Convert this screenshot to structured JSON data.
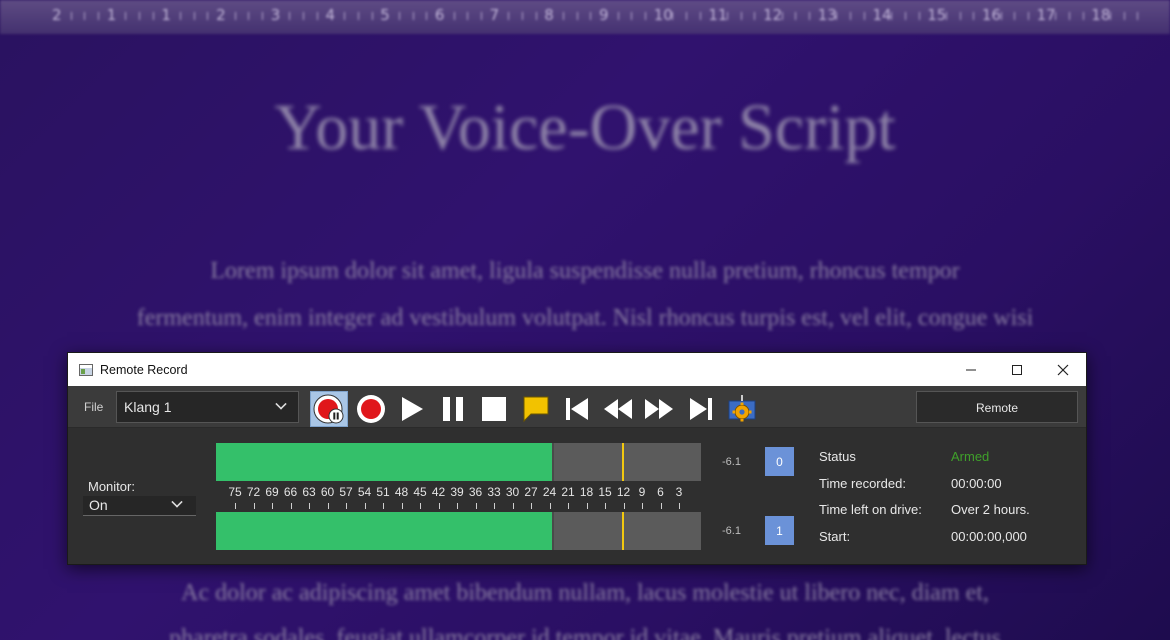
{
  "background": {
    "ruler_numbers": [
      "2",
      "1",
      "1",
      "2",
      "3",
      "4",
      "5",
      "6",
      "7",
      "8",
      "9",
      "10",
      "11",
      "12",
      "13",
      "14",
      "15",
      "16",
      "17",
      "18"
    ],
    "title": "Your Voice-Over Script",
    "paragraph_lines": [
      "Lorem ipsum dolor sit amet, ligula suspendisse nulla pretium, rhoncus tempor",
      "fermentum, enim integer ad vestibulum volutpat. Nisl rhoncus turpis est, vel elit, congue wisi",
      "Ac dolor ac adipiscing amet bibendum nullam, lacus molestie ut libero nec, diam et,",
      "pharetra sodales, feugiat ullamcorper id tempor id vitae. Mauris pretium aliquet, lectus"
    ]
  },
  "window": {
    "title": "Remote Record",
    "controls": {
      "minimize": "—",
      "maximize": "☐",
      "close": "✕"
    }
  },
  "toolbar": {
    "file_label": "File",
    "file_value": "Klang 1",
    "buttons": [
      {
        "name": "record-pause-button",
        "icon": "record-pause-icon",
        "active": true
      },
      {
        "name": "record-button",
        "icon": "record-icon"
      },
      {
        "name": "play-button",
        "icon": "play-icon"
      },
      {
        "name": "pause-button",
        "icon": "pause-icon"
      },
      {
        "name": "stop-button",
        "icon": "stop-icon"
      },
      {
        "name": "marker-button",
        "icon": "marker-flag-icon"
      },
      {
        "name": "skip-to-start-button",
        "icon": "skip-start-icon"
      },
      {
        "name": "rewind-button",
        "icon": "rewind-icon"
      },
      {
        "name": "fast-forward-button",
        "icon": "fast-forward-icon"
      },
      {
        "name": "skip-to-end-button",
        "icon": "skip-end-icon"
      },
      {
        "name": "settings-button",
        "icon": "gear-settings-icon"
      }
    ],
    "remote_label": "Remote"
  },
  "monitor": {
    "label": "Monitor:",
    "value": "On"
  },
  "meters": {
    "scale_labels": [
      "75",
      "72",
      "69",
      "66",
      "63",
      "60",
      "57",
      "54",
      "51",
      "48",
      "45",
      "42",
      "39",
      "36",
      "33",
      "30",
      "27",
      "24",
      "21",
      "18",
      "15",
      "12",
      "9",
      "6",
      "3"
    ],
    "channels": [
      {
        "channel": "0",
        "readout": "-6.1",
        "level_fraction": 0.695,
        "peak_fraction": 0.838
      },
      {
        "channel": "1",
        "readout": "-6.1",
        "level_fraction": 0.695,
        "peak_fraction": 0.838
      }
    ]
  },
  "info": {
    "status_label": "Status",
    "status_value": "Armed",
    "time_recorded_label": "Time recorded:",
    "time_recorded_value": "00:00:00",
    "time_left_label": "Time left on drive:",
    "time_left_value": "Over 2 hours.",
    "start_label": "Start:",
    "start_value": "00:00:00,000"
  },
  "colors": {
    "meter_fill": "#34c06a",
    "peak_marker": "#f2c80f",
    "status_armed": "#3fa02a",
    "channel_badge": "#6b92d8",
    "record_red": "#e0161b",
    "marker_yellow": "#f2c200"
  }
}
